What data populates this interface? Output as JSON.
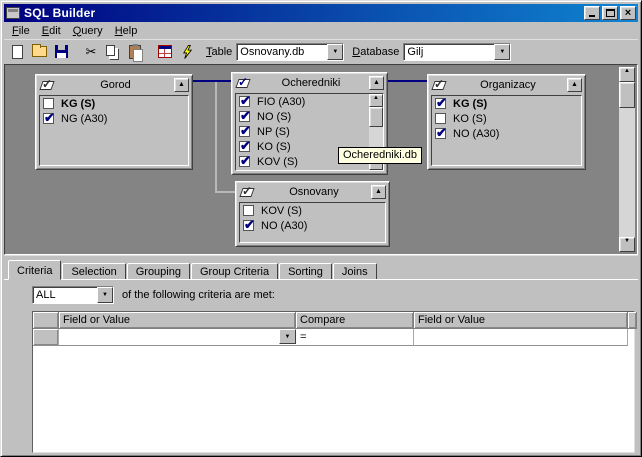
{
  "window": {
    "title": "SQL Builder"
  },
  "title_buttons": {
    "minimize": "minimize",
    "maximize": "maximize",
    "close": "close"
  },
  "menu": {
    "items": [
      "File",
      "Edit",
      "Query",
      "Help"
    ]
  },
  "toolbar": {
    "table_label": "Table",
    "table_value": "Osnovany.db",
    "database_label": "Database",
    "database_value": "Gilj",
    "icons": [
      "new-document",
      "open-folder",
      "save-disk",
      "cut-scissors",
      "copy-pages",
      "paste-clipboard",
      "sql-table-grid",
      "run-lightning"
    ]
  },
  "diagram": {
    "tooltip": "Ocheredniki.db",
    "tables": [
      {
        "name": "Gorod",
        "fields": [
          {
            "name": "KG (S)",
            "checked": false,
            "bold": true
          },
          {
            "name": "NG (A30)",
            "checked": true,
            "bold": false
          }
        ]
      },
      {
        "name": "Ocheredniki",
        "fields": [
          {
            "name": "FIO (A30)",
            "checked": true,
            "bold": false
          },
          {
            "name": "NO (S)",
            "checked": true,
            "bold": false
          },
          {
            "name": "NP (S)",
            "checked": true,
            "bold": false
          },
          {
            "name": "KO (S)",
            "checked": true,
            "bold": false
          },
          {
            "name": "KOV (S)",
            "checked": true,
            "bold": false
          }
        ]
      },
      {
        "name": "Organizacy",
        "fields": [
          {
            "name": "KG (S)",
            "checked": true,
            "bold": true
          },
          {
            "name": "KO (S)",
            "checked": false,
            "bold": false
          },
          {
            "name": "NO (A30)",
            "checked": true,
            "bold": false
          }
        ]
      },
      {
        "name": "Osnovany",
        "fields": [
          {
            "name": "KOV (S)",
            "checked": false,
            "bold": false
          },
          {
            "name": "NO (A30)",
            "checked": true,
            "bold": false
          }
        ]
      }
    ]
  },
  "tabs": [
    "Criteria",
    "Selection",
    "Grouping",
    "Group Criteria",
    "Sorting",
    "Joins"
  ],
  "criteria": {
    "match_mode": "ALL",
    "description": "of the following criteria are met:",
    "grid": {
      "headers": [
        "Field or Value",
        "Compare",
        "Field or Value"
      ],
      "rows": [
        {
          "field1": "",
          "compare": "=",
          "field2": ""
        }
      ]
    }
  },
  "colors": {
    "title_gradient_start": "#000080",
    "title_gradient_end": "#1084d0",
    "chrome": "#c0c0c0",
    "workarea_bg": "#848484",
    "accent_navy": "#000080",
    "tooltip_bg": "#ffffe1"
  }
}
